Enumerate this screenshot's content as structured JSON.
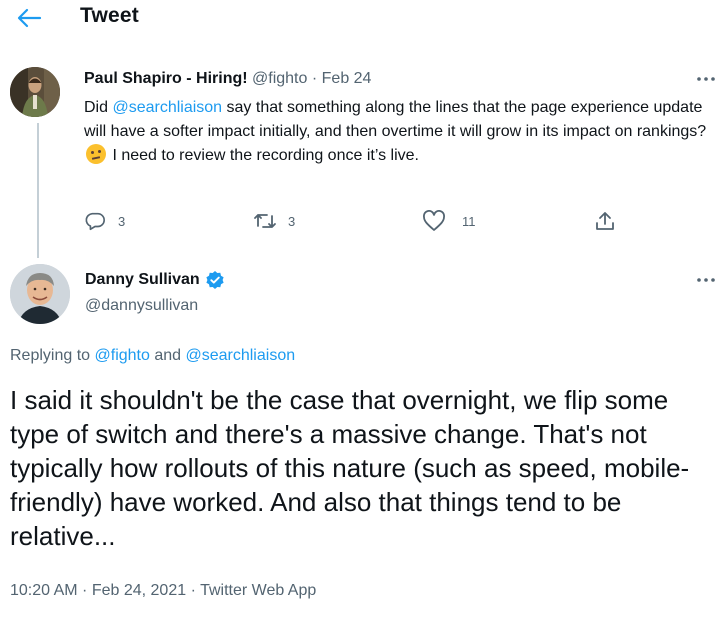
{
  "header": {
    "title": "Tweet",
    "back_icon": "arrow-left-icon"
  },
  "colors": {
    "accent": "#1d9bf0",
    "muted": "#536471",
    "text": "#0f1419",
    "verified": "#1d9bf0"
  },
  "tweet1": {
    "author_name": "Paul Shapiro - Hiring!",
    "handle": "@fighto",
    "separator": "·",
    "date": "Feb 24",
    "body": {
      "before": "Did ",
      "mention": "@searchliaison",
      "after": " say that something along the lines that the page experience update will have a softer impact initially, and then overtime it will grow in its impact on rankings? ",
      "emoji": "thinking-face-emoji",
      "end": " I need to review the recording once it’s live."
    },
    "actions": {
      "reply_count": "3",
      "retweet_count": "3",
      "like_count": "11"
    }
  },
  "tweet2": {
    "author_name": "Danny Sullivan",
    "handle": "@dannysullivan",
    "replying": {
      "prefix": "Replying to ",
      "mention1": "@fighto",
      "conj": " and ",
      "mention2": "@searchliaison"
    },
    "body": "I said it shouldn't be the case that overnight, we flip some type of switch and there's a massive change. That's not typically how rollouts of this nature (such as speed, mobile-friendly) have worked. And also that things tend to be relative...",
    "time": "10:20 AM",
    "date": "Feb 24, 2021",
    "source": "Twitter Web App",
    "separator": " · "
  }
}
